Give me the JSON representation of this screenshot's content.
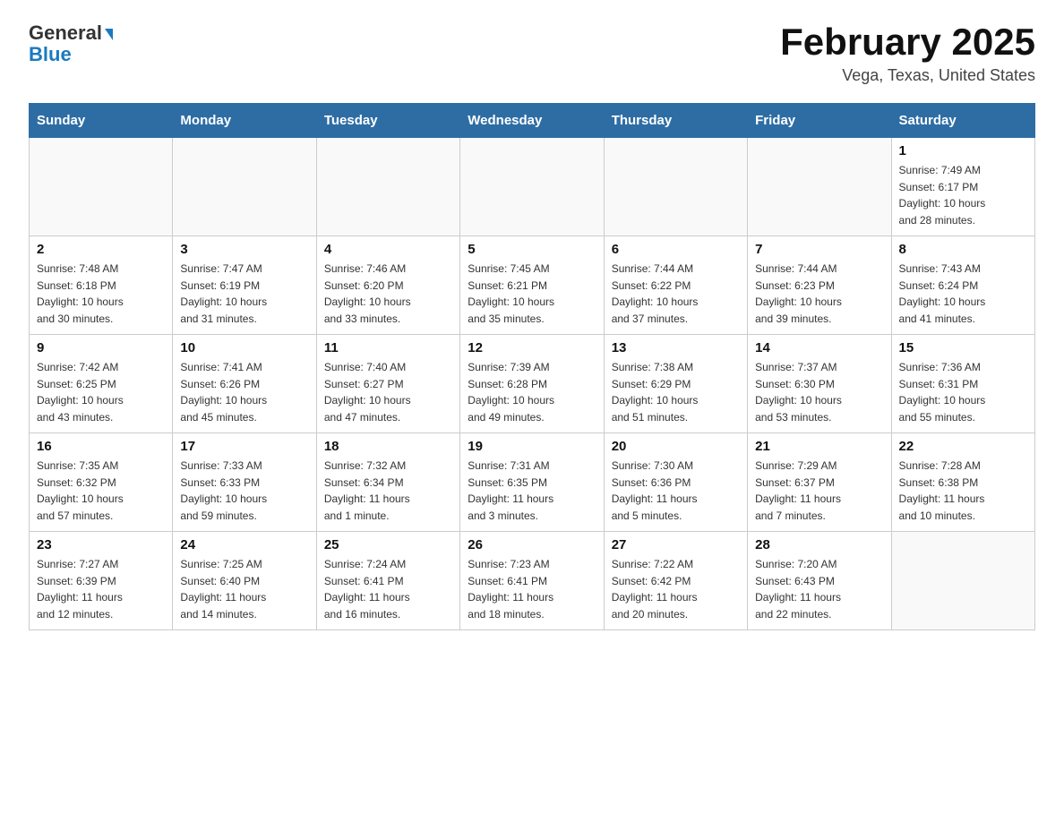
{
  "header": {
    "logo_general": "General",
    "logo_blue": "Blue",
    "month_title": "February 2025",
    "location": "Vega, Texas, United States"
  },
  "weekdays": [
    "Sunday",
    "Monday",
    "Tuesday",
    "Wednesday",
    "Thursday",
    "Friday",
    "Saturday"
  ],
  "weeks": [
    [
      {
        "day": "",
        "info": ""
      },
      {
        "day": "",
        "info": ""
      },
      {
        "day": "",
        "info": ""
      },
      {
        "day": "",
        "info": ""
      },
      {
        "day": "",
        "info": ""
      },
      {
        "day": "",
        "info": ""
      },
      {
        "day": "1",
        "info": "Sunrise: 7:49 AM\nSunset: 6:17 PM\nDaylight: 10 hours\nand 28 minutes."
      }
    ],
    [
      {
        "day": "2",
        "info": "Sunrise: 7:48 AM\nSunset: 6:18 PM\nDaylight: 10 hours\nand 30 minutes."
      },
      {
        "day": "3",
        "info": "Sunrise: 7:47 AM\nSunset: 6:19 PM\nDaylight: 10 hours\nand 31 minutes."
      },
      {
        "day": "4",
        "info": "Sunrise: 7:46 AM\nSunset: 6:20 PM\nDaylight: 10 hours\nand 33 minutes."
      },
      {
        "day": "5",
        "info": "Sunrise: 7:45 AM\nSunset: 6:21 PM\nDaylight: 10 hours\nand 35 minutes."
      },
      {
        "day": "6",
        "info": "Sunrise: 7:44 AM\nSunset: 6:22 PM\nDaylight: 10 hours\nand 37 minutes."
      },
      {
        "day": "7",
        "info": "Sunrise: 7:44 AM\nSunset: 6:23 PM\nDaylight: 10 hours\nand 39 minutes."
      },
      {
        "day": "8",
        "info": "Sunrise: 7:43 AM\nSunset: 6:24 PM\nDaylight: 10 hours\nand 41 minutes."
      }
    ],
    [
      {
        "day": "9",
        "info": "Sunrise: 7:42 AM\nSunset: 6:25 PM\nDaylight: 10 hours\nand 43 minutes."
      },
      {
        "day": "10",
        "info": "Sunrise: 7:41 AM\nSunset: 6:26 PM\nDaylight: 10 hours\nand 45 minutes."
      },
      {
        "day": "11",
        "info": "Sunrise: 7:40 AM\nSunset: 6:27 PM\nDaylight: 10 hours\nand 47 minutes."
      },
      {
        "day": "12",
        "info": "Sunrise: 7:39 AM\nSunset: 6:28 PM\nDaylight: 10 hours\nand 49 minutes."
      },
      {
        "day": "13",
        "info": "Sunrise: 7:38 AM\nSunset: 6:29 PM\nDaylight: 10 hours\nand 51 minutes."
      },
      {
        "day": "14",
        "info": "Sunrise: 7:37 AM\nSunset: 6:30 PM\nDaylight: 10 hours\nand 53 minutes."
      },
      {
        "day": "15",
        "info": "Sunrise: 7:36 AM\nSunset: 6:31 PM\nDaylight: 10 hours\nand 55 minutes."
      }
    ],
    [
      {
        "day": "16",
        "info": "Sunrise: 7:35 AM\nSunset: 6:32 PM\nDaylight: 10 hours\nand 57 minutes."
      },
      {
        "day": "17",
        "info": "Sunrise: 7:33 AM\nSunset: 6:33 PM\nDaylight: 10 hours\nand 59 minutes."
      },
      {
        "day": "18",
        "info": "Sunrise: 7:32 AM\nSunset: 6:34 PM\nDaylight: 11 hours\nand 1 minute."
      },
      {
        "day": "19",
        "info": "Sunrise: 7:31 AM\nSunset: 6:35 PM\nDaylight: 11 hours\nand 3 minutes."
      },
      {
        "day": "20",
        "info": "Sunrise: 7:30 AM\nSunset: 6:36 PM\nDaylight: 11 hours\nand 5 minutes."
      },
      {
        "day": "21",
        "info": "Sunrise: 7:29 AM\nSunset: 6:37 PM\nDaylight: 11 hours\nand 7 minutes."
      },
      {
        "day": "22",
        "info": "Sunrise: 7:28 AM\nSunset: 6:38 PM\nDaylight: 11 hours\nand 10 minutes."
      }
    ],
    [
      {
        "day": "23",
        "info": "Sunrise: 7:27 AM\nSunset: 6:39 PM\nDaylight: 11 hours\nand 12 minutes."
      },
      {
        "day": "24",
        "info": "Sunrise: 7:25 AM\nSunset: 6:40 PM\nDaylight: 11 hours\nand 14 minutes."
      },
      {
        "day": "25",
        "info": "Sunrise: 7:24 AM\nSunset: 6:41 PM\nDaylight: 11 hours\nand 16 minutes."
      },
      {
        "day": "26",
        "info": "Sunrise: 7:23 AM\nSunset: 6:41 PM\nDaylight: 11 hours\nand 18 minutes."
      },
      {
        "day": "27",
        "info": "Sunrise: 7:22 AM\nSunset: 6:42 PM\nDaylight: 11 hours\nand 20 minutes."
      },
      {
        "day": "28",
        "info": "Sunrise: 7:20 AM\nSunset: 6:43 PM\nDaylight: 11 hours\nand 22 minutes."
      },
      {
        "day": "",
        "info": ""
      }
    ]
  ]
}
